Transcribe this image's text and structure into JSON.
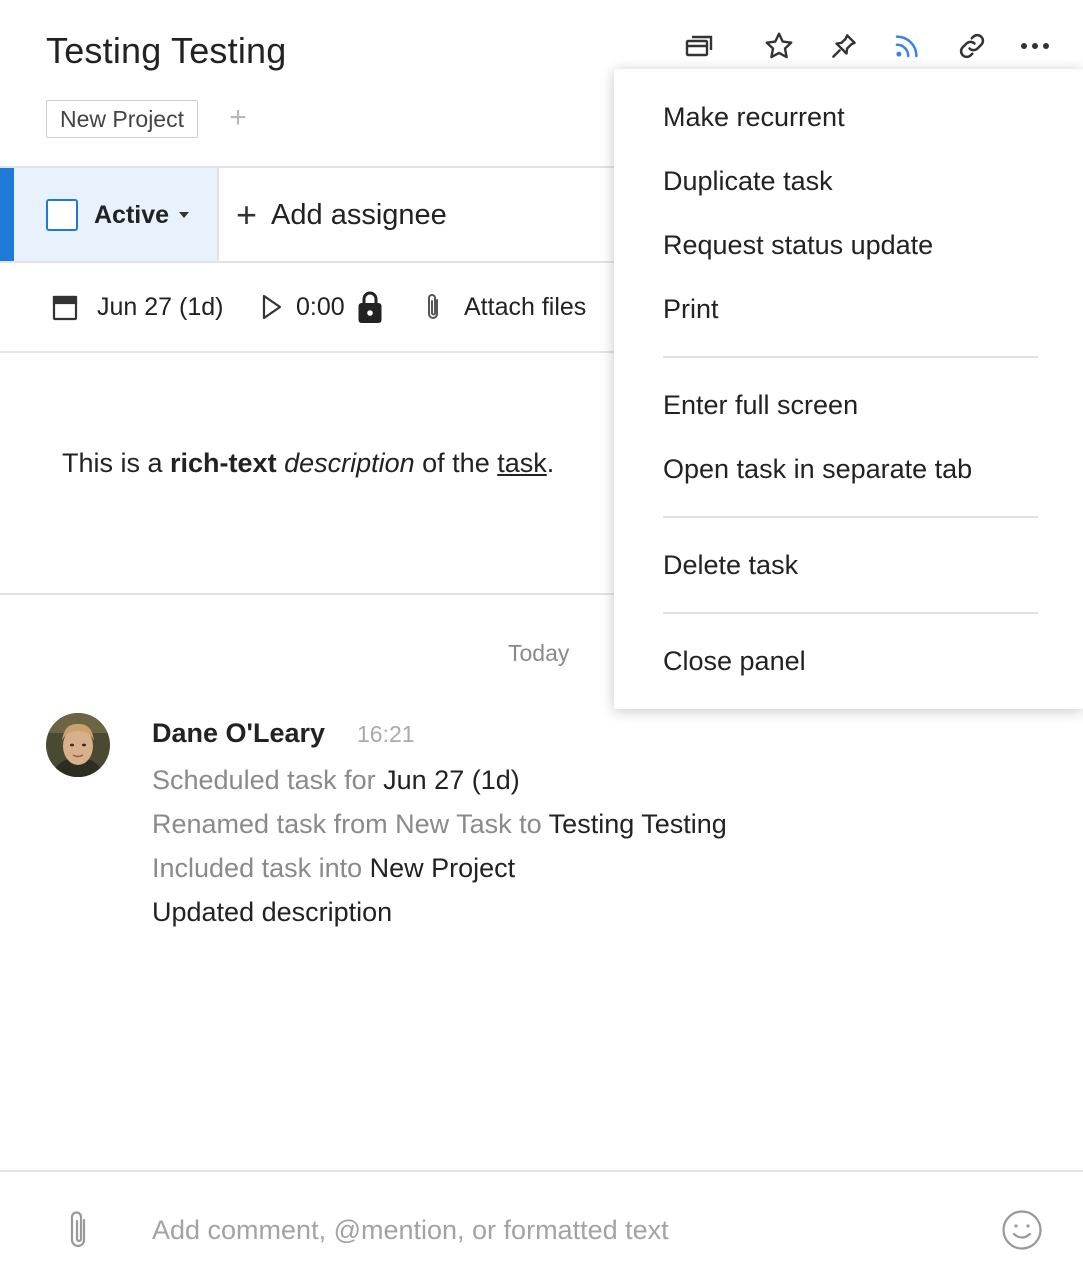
{
  "task": {
    "title": "Testing Testing",
    "project_tag": "New Project",
    "add_tag": "+",
    "status": "Active",
    "add_assignee": "Add assignee",
    "add_assignee_icon": "+",
    "date": "Jun 27 (1d)",
    "timer": "0:00",
    "attach_files": "Attach files"
  },
  "description": {
    "part1": "This is a ",
    "bold": "rich-text",
    "part2": " ",
    "italic": "description",
    "part3": " of the ",
    "underline": "task",
    "part4": "."
  },
  "activity": {
    "date_separator": "Today",
    "author": "Dane O'Leary",
    "time": "16:21",
    "entries": [
      {
        "muted": "Scheduled task for ",
        "value": "Jun 27 (1d)"
      },
      {
        "muted": "Renamed task from New Task to ",
        "value": "Testing Testing"
      },
      {
        "muted": "Included task into ",
        "value": "New Project"
      },
      {
        "muted": "",
        "value": "Updated description"
      }
    ]
  },
  "comment": {
    "placeholder": "Add comment, @mention, or formatted text"
  },
  "menu": {
    "items": [
      "Make recurrent",
      "Duplicate task",
      "Request status update",
      "Print",
      "Enter full screen",
      "Open task in separate tab",
      "Delete task",
      "Close panel"
    ]
  },
  "toolbar": {
    "icons": [
      "subtasks-icon",
      "star-icon",
      "pin-icon",
      "follow-feed-icon",
      "link-icon",
      "more-icon"
    ]
  },
  "colors": {
    "accent": "#1e7ad6",
    "active_bg": "#e7f2fc",
    "follow_icon": "#3b82e6",
    "muted_text": "#8a8a8a"
  }
}
